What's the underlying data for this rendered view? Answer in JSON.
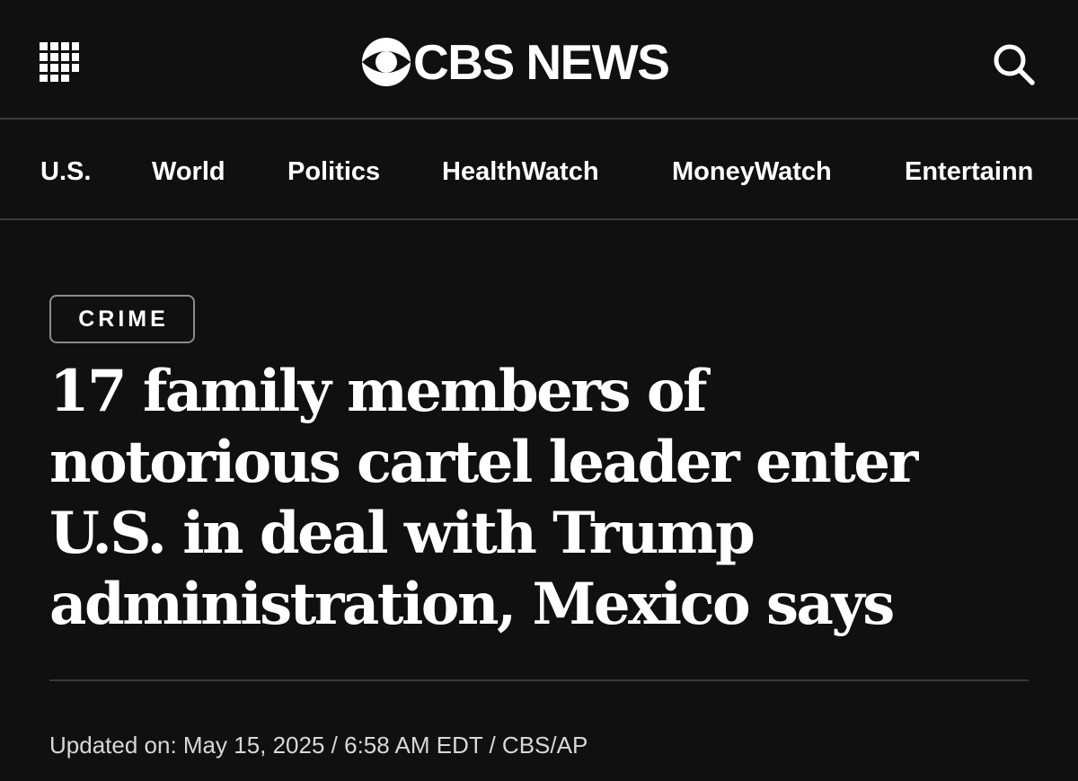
{
  "header": {
    "menu_icon": "grid-menu-icon",
    "logo_icon": "cbs-eye-icon",
    "logo_text": "CBS NEWS",
    "search_icon": "search-icon"
  },
  "nav": {
    "items": [
      {
        "label": "U.S."
      },
      {
        "label": "World"
      },
      {
        "label": "Politics"
      },
      {
        "label": "HealthWatch"
      },
      {
        "label": "MoneyWatch"
      },
      {
        "label": "Entertainn"
      }
    ]
  },
  "article": {
    "category": "CRIME",
    "headline": "17 family members of notorious cartel leader enter U.S. in deal with Trump administration, Mexico says",
    "byline": "Updated on: May 15, 2025 / 6:58 AM EDT / CBS/AP"
  },
  "colors": {
    "background": "#101010",
    "text": "#ffffff",
    "divider": "#3a3a3a",
    "badge_border": "#8a8a8a",
    "byline": "#d8d8d8"
  }
}
